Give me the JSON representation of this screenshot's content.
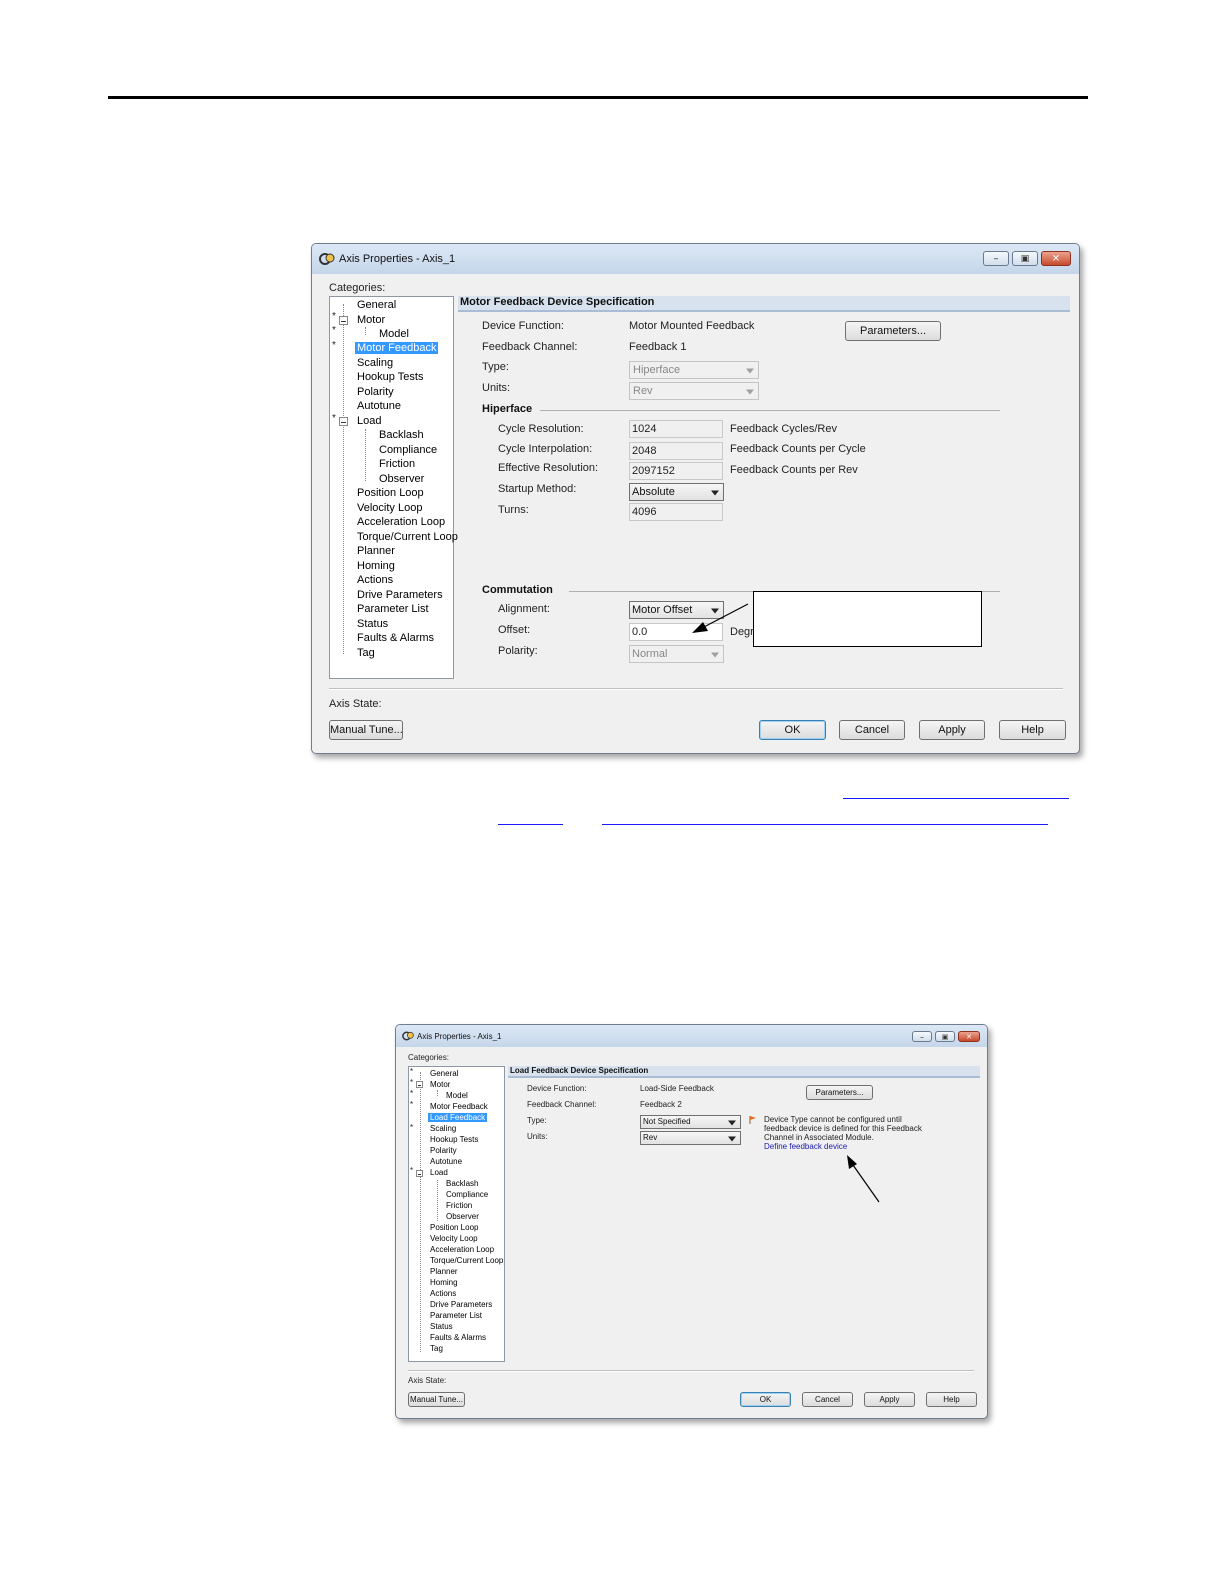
{
  "dialog1": {
    "title": "Axis Properties - Axis_1",
    "categories_label": "Categories:",
    "tree": {
      "general": "General",
      "motor": "Motor",
      "model": "Model",
      "motor_feedback": "Motor Feedback",
      "scaling": "Scaling",
      "hookup_tests": "Hookup Tests",
      "polarity": "Polarity",
      "autotune": "Autotune",
      "load": "Load",
      "backlash": "Backlash",
      "compliance": "Compliance",
      "friction": "Friction",
      "observer": "Observer",
      "position_loop": "Position Loop",
      "velocity_loop": "Velocity Loop",
      "acceleration_loop": "Acceleration Loop",
      "torque_current_loop": "Torque/Current Loop",
      "planner": "Planner",
      "homing": "Homing",
      "actions": "Actions",
      "drive_parameters": "Drive Parameters",
      "parameter_list": "Parameter List",
      "status": "Status",
      "faults_alarms": "Faults & Alarms",
      "tag": "Tag"
    },
    "section_header": "Motor Feedback Device Specification",
    "device_function_label": "Device Function:",
    "device_function_value": "Motor Mounted Feedback",
    "parameters_button": "Parameters...",
    "feedback_channel_label": "Feedback Channel:",
    "feedback_channel_value": "Feedback 1",
    "type_label": "Type:",
    "type_value": "Hiperface",
    "units_label": "Units:",
    "units_value": "Rev",
    "hiperface_group": "Hiperface",
    "cycle_resolution_label": "Cycle Resolution:",
    "cycle_resolution_value": "1024",
    "cycle_resolution_unit": "Feedback Cycles/Rev",
    "cycle_interpolation_label": "Cycle Interpolation:",
    "cycle_interpolation_value": "2048",
    "cycle_interpolation_unit": "Feedback Counts per Cycle",
    "effective_resolution_label": "Effective Resolution:",
    "effective_resolution_value": "2097152",
    "effective_resolution_unit": "Feedback Counts per Rev",
    "startup_method_label": "Startup Method:",
    "startup_method_value": "Absolute",
    "turns_label": "Turns:",
    "turns_value": "4096",
    "commutation_group": "Commutation",
    "alignment_label": "Alignment:",
    "alignment_value": "Motor Offset",
    "offset_label": "Offset:",
    "offset_value": "0.0",
    "offset_unit": "Degre",
    "polarity_label": "Polarity:",
    "polarity_value": "Normal",
    "axis_state_label": "Axis State:",
    "manual_tune_button": "Manual Tune...",
    "ok_button": "OK",
    "cancel_button": "Cancel",
    "apply_button": "Apply",
    "help_button": "Help"
  },
  "dialog2": {
    "title": "Axis Properties - Axis_1",
    "categories_label": "Categories:",
    "tree": {
      "general": "General",
      "motor": "Motor",
      "model": "Model",
      "motor_feedback": "Motor Feedback",
      "load_feedback": "Load Feedback",
      "scaling": "Scaling",
      "hookup_tests": "Hookup Tests",
      "polarity": "Polarity",
      "autotune": "Autotune",
      "load": "Load",
      "backlash": "Backlash",
      "compliance": "Compliance",
      "friction": "Friction",
      "observer": "Observer",
      "position_loop": "Position Loop",
      "velocity_loop": "Velocity Loop",
      "acceleration_loop": "Acceleration Loop",
      "torque_current_loop": "Torque/Current Loop",
      "planner": "Planner",
      "homing": "Homing",
      "actions": "Actions",
      "drive_parameters": "Drive Parameters",
      "parameter_list": "Parameter List",
      "status": "Status",
      "faults_alarms": "Faults & Alarms",
      "tag": "Tag"
    },
    "section_header": "Load Feedback Device Specification",
    "device_function_label": "Device Function:",
    "device_function_value": "Load-Side Feedback",
    "parameters_button": "Parameters...",
    "feedback_channel_label": "Feedback Channel:",
    "feedback_channel_value": "Feedback 2",
    "type_label": "Type:",
    "type_value": "Not Specified",
    "units_label": "Units:",
    "units_value": "Rev",
    "warning_line1": "Device Type cannot be configured until",
    "warning_line2": "feedback device is defined for this Feedback",
    "warning_line3": "Channel in Associated Module.",
    "define_link": "Define feedback device",
    "axis_state_label": "Axis State:",
    "manual_tune_button": "Manual Tune...",
    "ok_button": "OK",
    "cancel_button": "Cancel",
    "apply_button": "Apply",
    "help_button": "Help"
  },
  "colors": {
    "selection": "#3399ff",
    "header_band": "#d8e2ee",
    "link": "#1a1ab0"
  }
}
